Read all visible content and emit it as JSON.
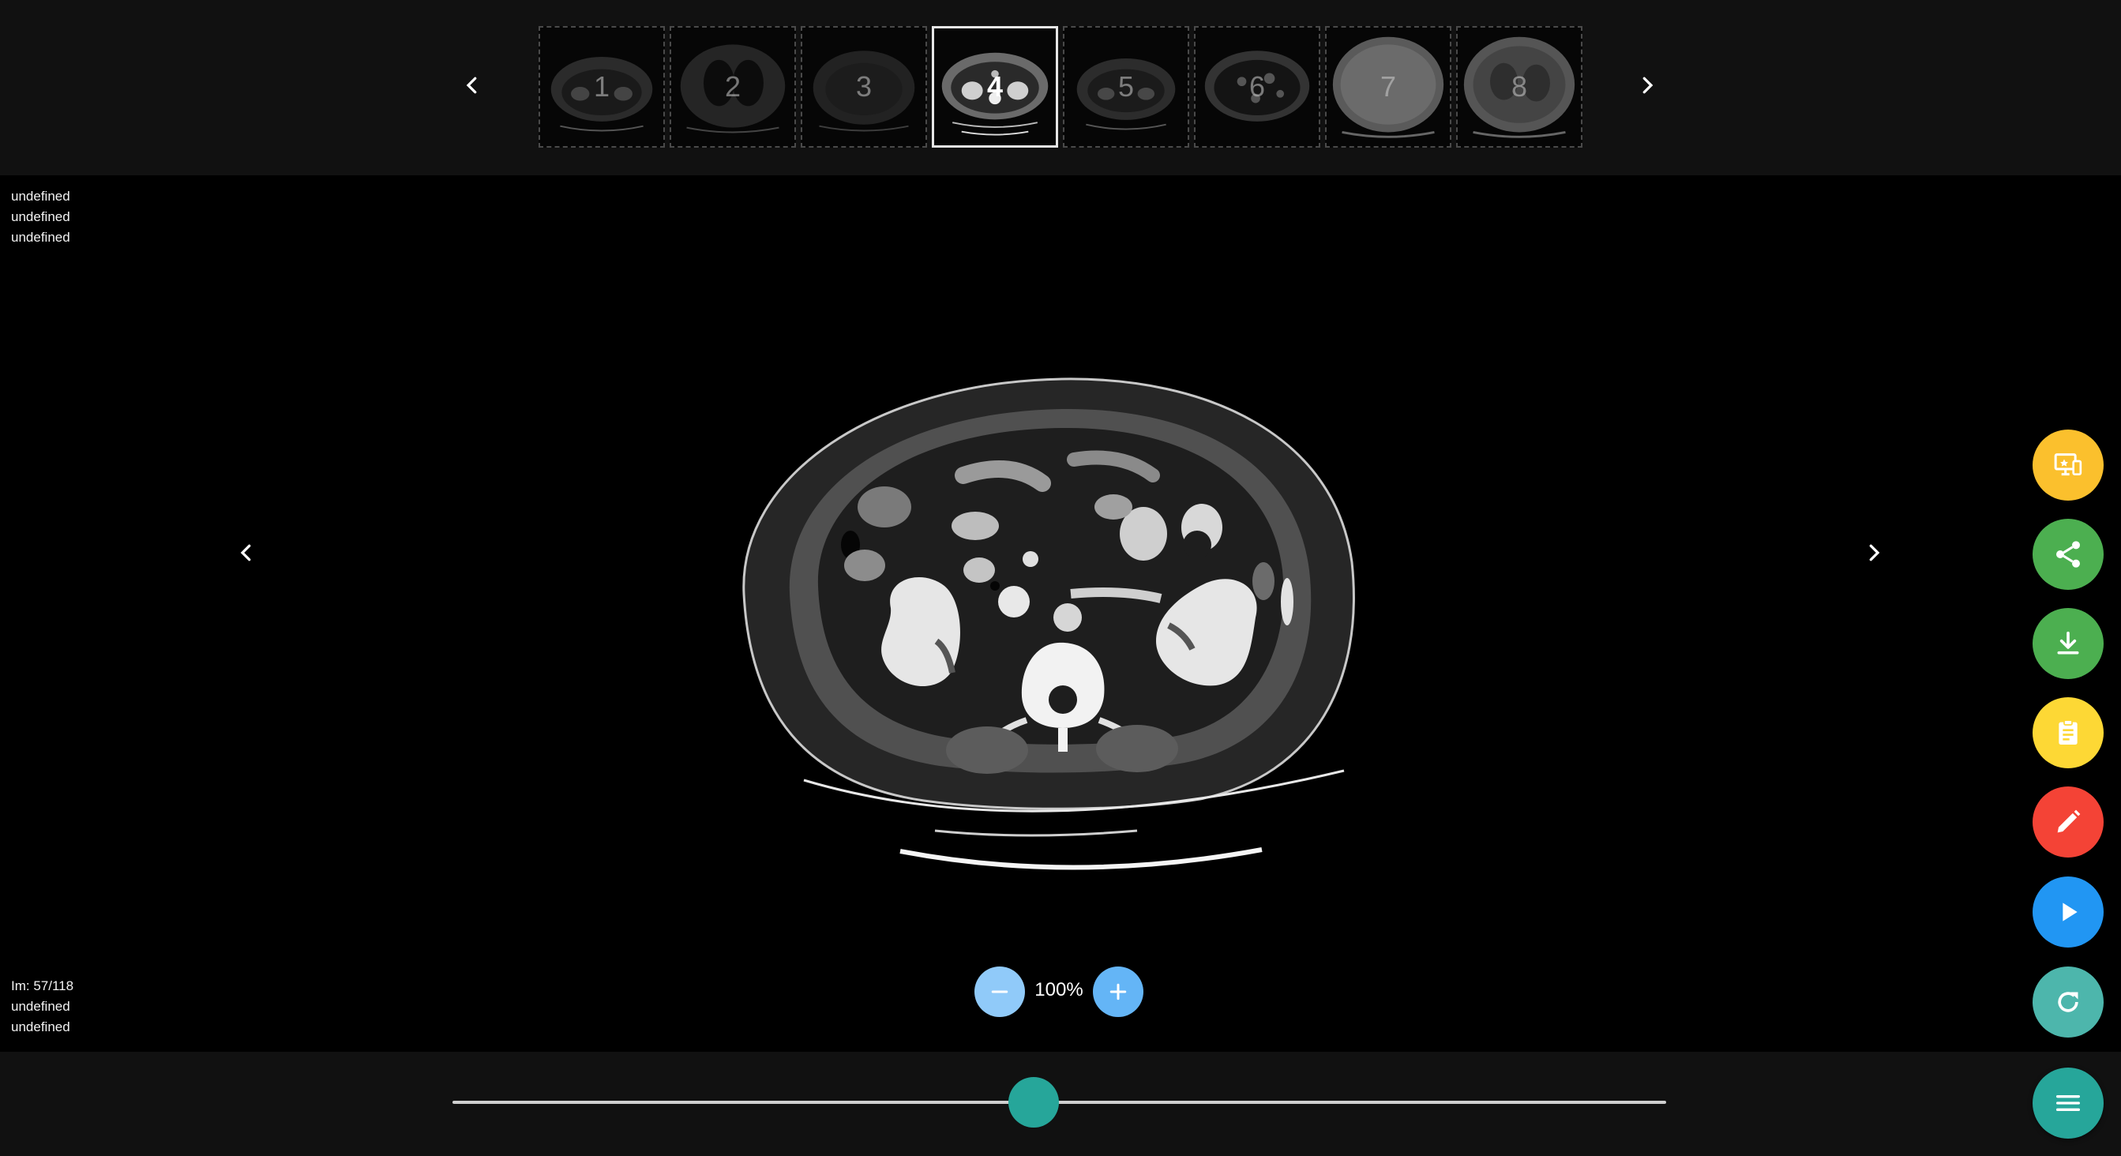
{
  "series_strip": {
    "thumbnails": [
      {
        "label": "1"
      },
      {
        "label": "2"
      },
      {
        "label": "3"
      },
      {
        "label": "4"
      },
      {
        "label": "5"
      },
      {
        "label": "6"
      },
      {
        "label": "7"
      },
      {
        "label": "8"
      }
    ],
    "selected_label": "4"
  },
  "viewer": {
    "overlay_top": [
      "undefined",
      "undefined",
      "undefined"
    ],
    "overlay_bottom": [
      "Im: 57/118",
      "undefined",
      "undefined"
    ],
    "zoom_level": "100%"
  },
  "slider": {
    "current_image": 57,
    "total_images": 118
  },
  "fabs": [
    {
      "name": "screen-share",
      "icon": "screen-share-icon",
      "color": "#fbc02d"
    },
    {
      "name": "share",
      "icon": "share-icon",
      "color": "#4caf50"
    },
    {
      "name": "download",
      "icon": "download-icon",
      "color": "#4caf50"
    },
    {
      "name": "report",
      "icon": "clipboard-icon",
      "color": "#fdd835"
    },
    {
      "name": "edit",
      "icon": "pencil-icon",
      "color": "#f44336"
    },
    {
      "name": "play",
      "icon": "play-icon",
      "color": "#2196f3"
    },
    {
      "name": "refresh",
      "icon": "refresh-icon",
      "color": "#4db6ac"
    },
    {
      "name": "menu",
      "icon": "menu-icon",
      "color": "#26a69a"
    }
  ],
  "colors": {
    "background": "#000000",
    "panel": "#111111",
    "accent_teal": "#26a69a",
    "zoom_blue": "#64b5f6"
  }
}
